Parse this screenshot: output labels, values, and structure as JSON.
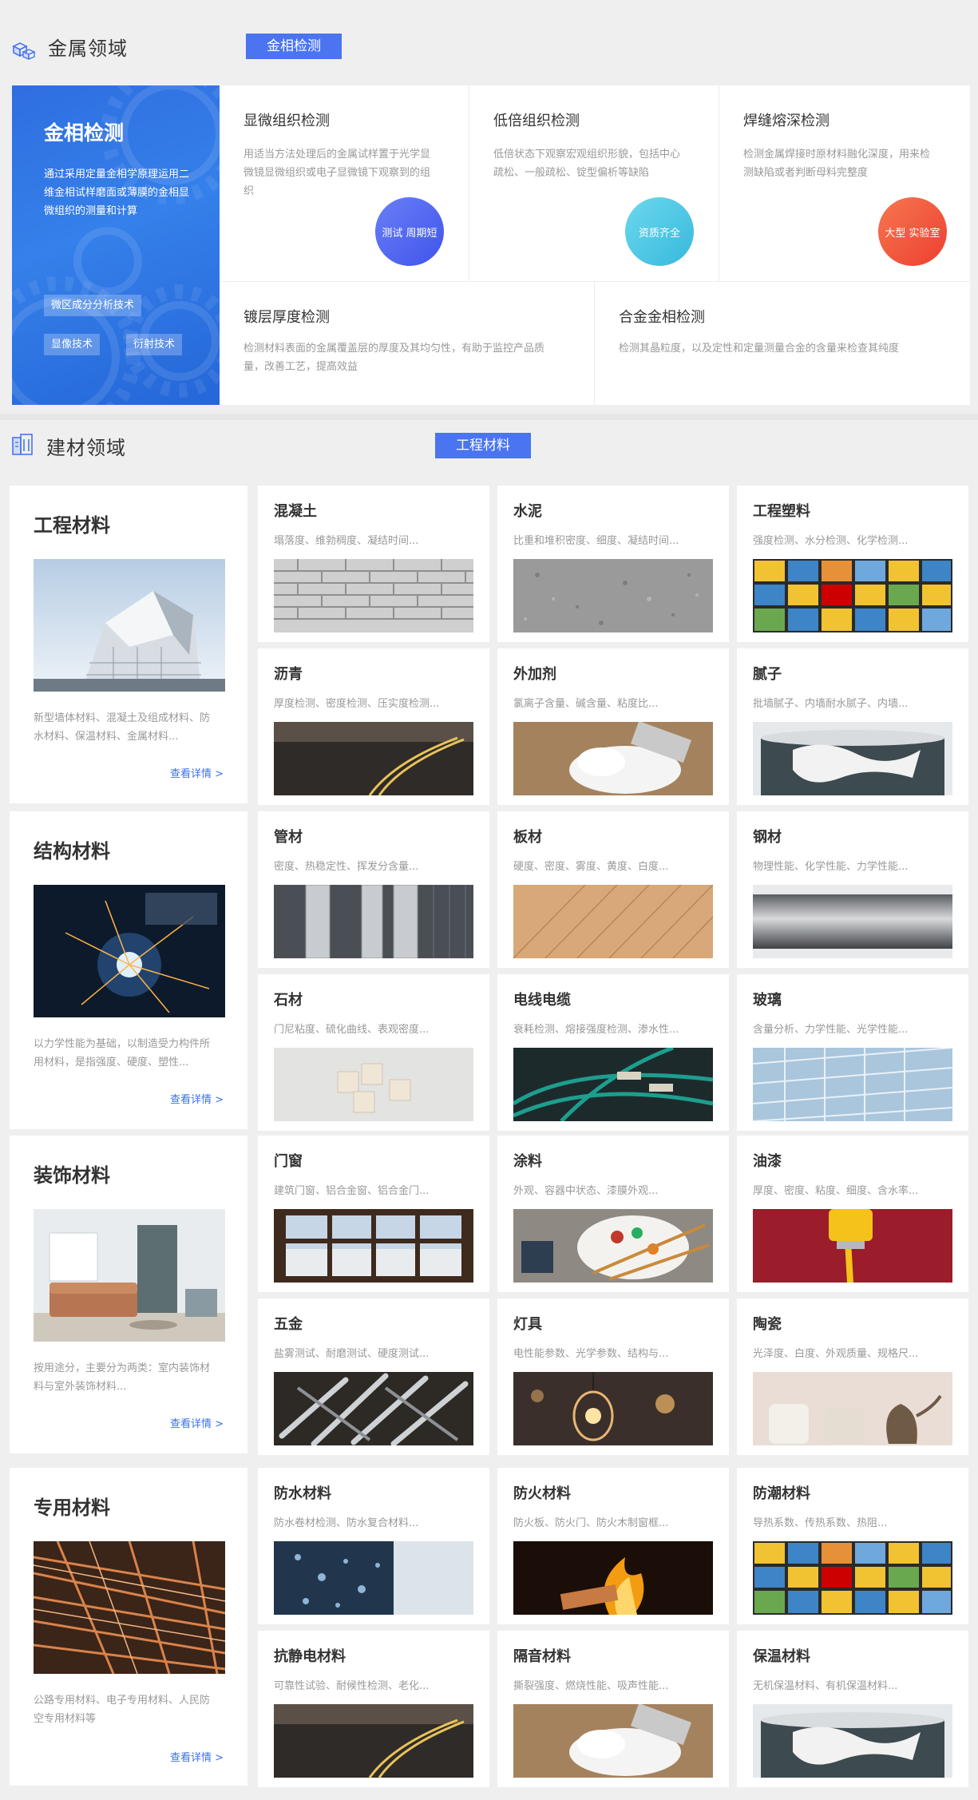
{
  "metal": {
    "title": "金属领域",
    "tab": "金相检测",
    "feature": {
      "title": "金相检测",
      "desc": "通过采用定量金相学原理运用二维金相试样磨面或薄膜的金相显微组织的测量和计算",
      "chips": [
        "微区成分分析技术",
        "显像技术",
        "衍射技术"
      ]
    },
    "cells": [
      {
        "title": "显微组织检测",
        "desc": [
          "用适当方法处理后的金属试样置于光学显",
          "微镜显微组织或电子显微镜下观察到的组",
          "织"
        ],
        "badge": "测试 周期短"
      },
      {
        "title": "低倍组织检测",
        "desc": [
          "低倍状态下观察宏观组织形貌，包括中心",
          "疏松、一般疏松、锭型偏析等缺陷"
        ],
        "badge": "资质齐全"
      },
      {
        "title": "焊缝熔深检测",
        "desc": [
          "检测金属焊接时原材料融化深度，用来检",
          "测缺陷或者判断母料完整度"
        ],
        "badge": "大型 实验室"
      },
      {
        "title": "镀层厚度检测",
        "desc": [
          "检测材料表面的金属覆盖层的厚度及其均匀性，有助于监控产品质",
          "量，改善工艺，提高效益"
        ]
      },
      {
        "title": "合金金相检测",
        "desc": [
          "检测其晶粒度，以及定性和定量测量合金的含量来检查其纯度"
        ]
      }
    ],
    "colors": {
      "badge1": "#4f63f0",
      "badge2": "#3fc2e0",
      "badge3": "#f0543a"
    }
  },
  "building": {
    "title": "建材领域",
    "tab": "工程材料",
    "more": "查看详情 >",
    "categories": [
      {
        "title": "工程材料",
        "desc": [
          "新型墙体材料、混凝土及组成材料、防",
          "水材料、保温材料、金属材料..."
        ]
      },
      {
        "title": "结构材料",
        "desc": [
          "以力学性能为基础，以制造受力构件所",
          "用材料，是指强度、硬度、塑性..."
        ]
      },
      {
        "title": "装饰材料",
        "desc": [
          "按用途分，主要分为两类：室内装饰材",
          "料与室外装饰材料..."
        ]
      },
      {
        "title": "专用材料",
        "desc": [
          "公路专用材料、电子专用材料、人民防",
          "空专用材料等"
        ]
      }
    ],
    "items": [
      {
        "title": "混凝土",
        "desc": "塌落度、维勃稠度、凝结时间..."
      },
      {
        "title": "水泥",
        "desc": "比重和堆积密度、细度、凝结时间..."
      },
      {
        "title": "工程塑料",
        "desc": "强度检测、水分检测、化学检测..."
      },
      {
        "title": "沥青",
        "desc": "厚度检测、密度检测、压实度检测..."
      },
      {
        "title": "外加剂",
        "desc": "氯离子含量、碱含量、粘度比..."
      },
      {
        "title": "腻子",
        "desc": "批墙腻子、内墙耐水腻子、内墙..."
      },
      {
        "title": "管材",
        "desc": "密度、热稳定性、挥发分含量..."
      },
      {
        "title": "板材",
        "desc": "硬度、密度、雾度、黄度、白度..."
      },
      {
        "title": "钢材",
        "desc": "物理性能、化学性能、力学性能..."
      },
      {
        "title": "石材",
        "desc": "门尼粘度、硫化曲线、表观密度..."
      },
      {
        "title": "电线电缆",
        "desc": "衰耗检测、熔接强度检测、渗水性..."
      },
      {
        "title": "玻璃",
        "desc": "含量分析、力学性能、光学性能..."
      },
      {
        "title": "门窗",
        "desc": "建筑门窗、铝合金窗、铝合金门..."
      },
      {
        "title": "涂料",
        "desc": "外观、容器中状态、漆膜外观..."
      },
      {
        "title": "油漆",
        "desc": "厚度、密度、粘度、细度、含水率..."
      },
      {
        "title": "五金",
        "desc": "盐雾测试、耐磨测试、硬度测试..."
      },
      {
        "title": "灯具",
        "desc": "电性能参数、光学参数、结构与..."
      },
      {
        "title": "陶瓷",
        "desc": "光泽度、白度、外观质量、规格尺..."
      },
      {
        "title": "防水材料",
        "desc": "防水卷材检测、防水复合材料..."
      },
      {
        "title": "防火材料",
        "desc": "防火板、防火门、防火木制窗框..."
      },
      {
        "title": "防潮材料",
        "desc": "导热系数、传热系数、热阻..."
      },
      {
        "title": "抗静电材料",
        "desc": "可靠性试验、耐候性检测、老化..."
      },
      {
        "title": "隔音材料",
        "desc": "撕裂强度、燃烧性能、吸声性能..."
      },
      {
        "title": "保温材料",
        "desc": "无机保温材料、有机保温材料..."
      }
    ],
    "colors": {
      "accent": "#4a74f0",
      "link": "#3b6ff0"
    }
  }
}
